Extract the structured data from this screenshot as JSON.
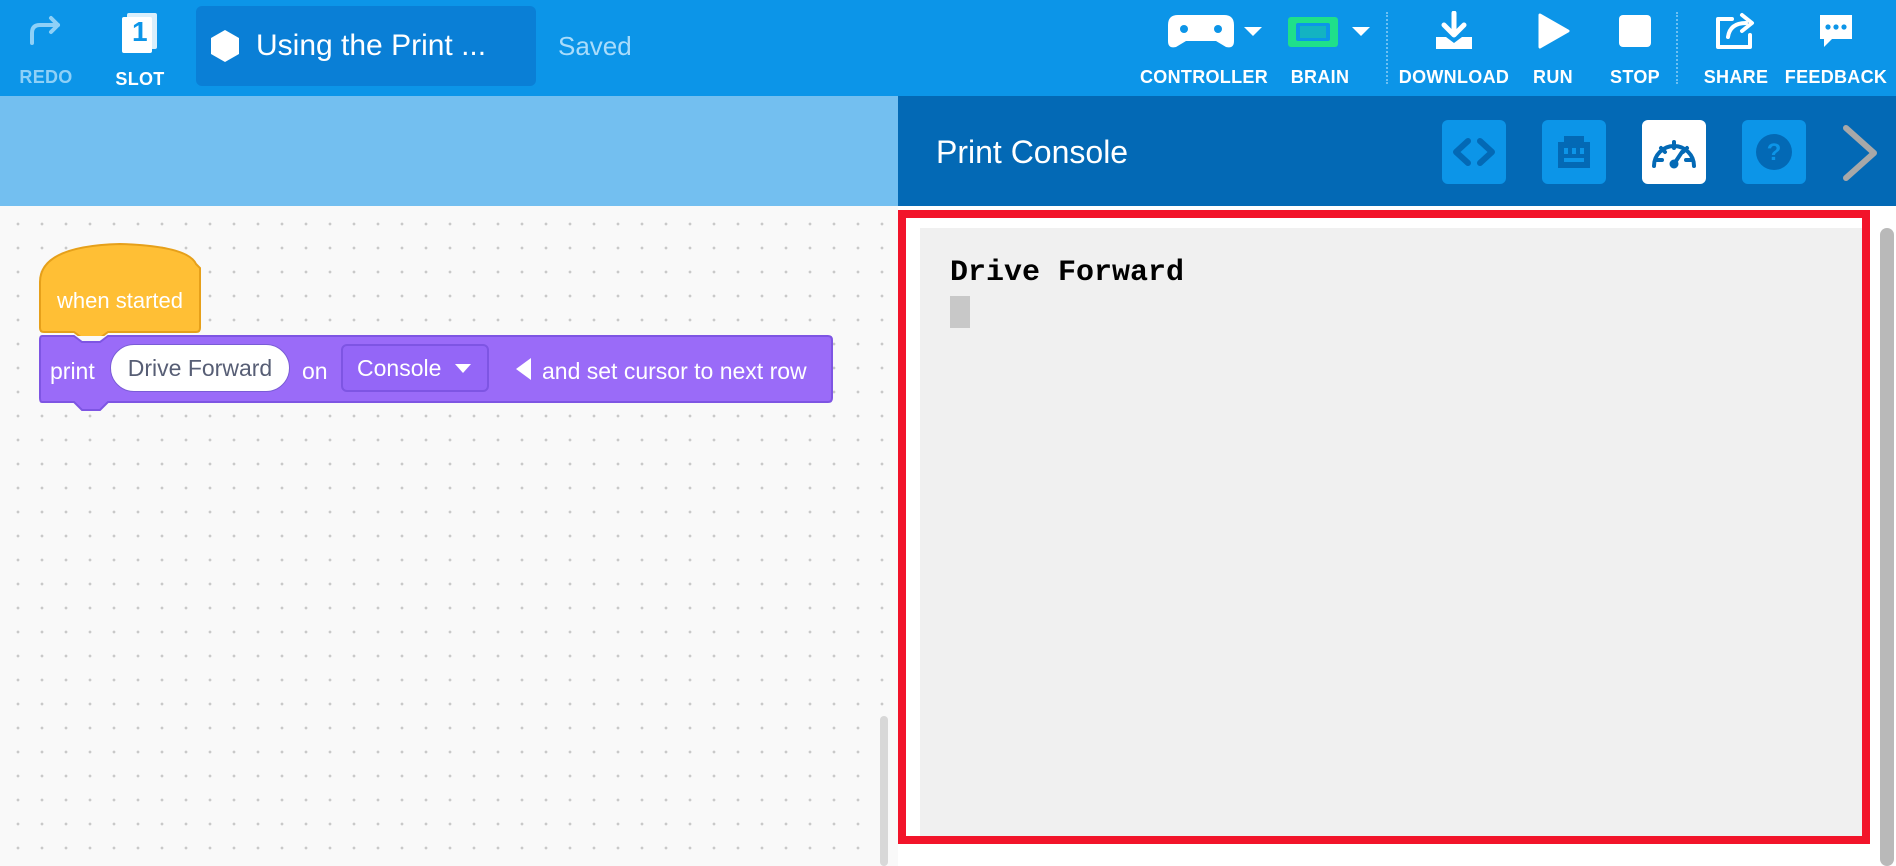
{
  "toolbar": {
    "redo_label": "REDO",
    "slot_label": "SLOT",
    "slot_number": "1",
    "project_title": "Using the Print ...",
    "save_status": "Saved",
    "controller_label": "CONTROLLER",
    "brain_label": "BRAIN",
    "download_label": "DOWNLOAD",
    "run_label": "RUN",
    "stop_label": "STOP",
    "share_label": "SHARE",
    "feedback_label": "FEEDBACK"
  },
  "blocks": {
    "hat_label": "when started",
    "print_word": "print",
    "print_value": "Drive Forward",
    "on_word": "on",
    "target_selected": "Console",
    "suffix": "and set cursor to next row"
  },
  "panel": {
    "title": "Print Console",
    "buttons": [
      "code-viewer-icon",
      "devices-icon",
      "dashboard-icon",
      "help-icon"
    ],
    "console_output": "Drive Forward"
  },
  "colors": {
    "toolbar": "#0c95e8",
    "panel_header": "#0369b5",
    "hat_block": "#ffbf35",
    "print_block": "#9a6bf8",
    "highlight": "#f2142a",
    "brain_icon": "#1fe08a"
  }
}
